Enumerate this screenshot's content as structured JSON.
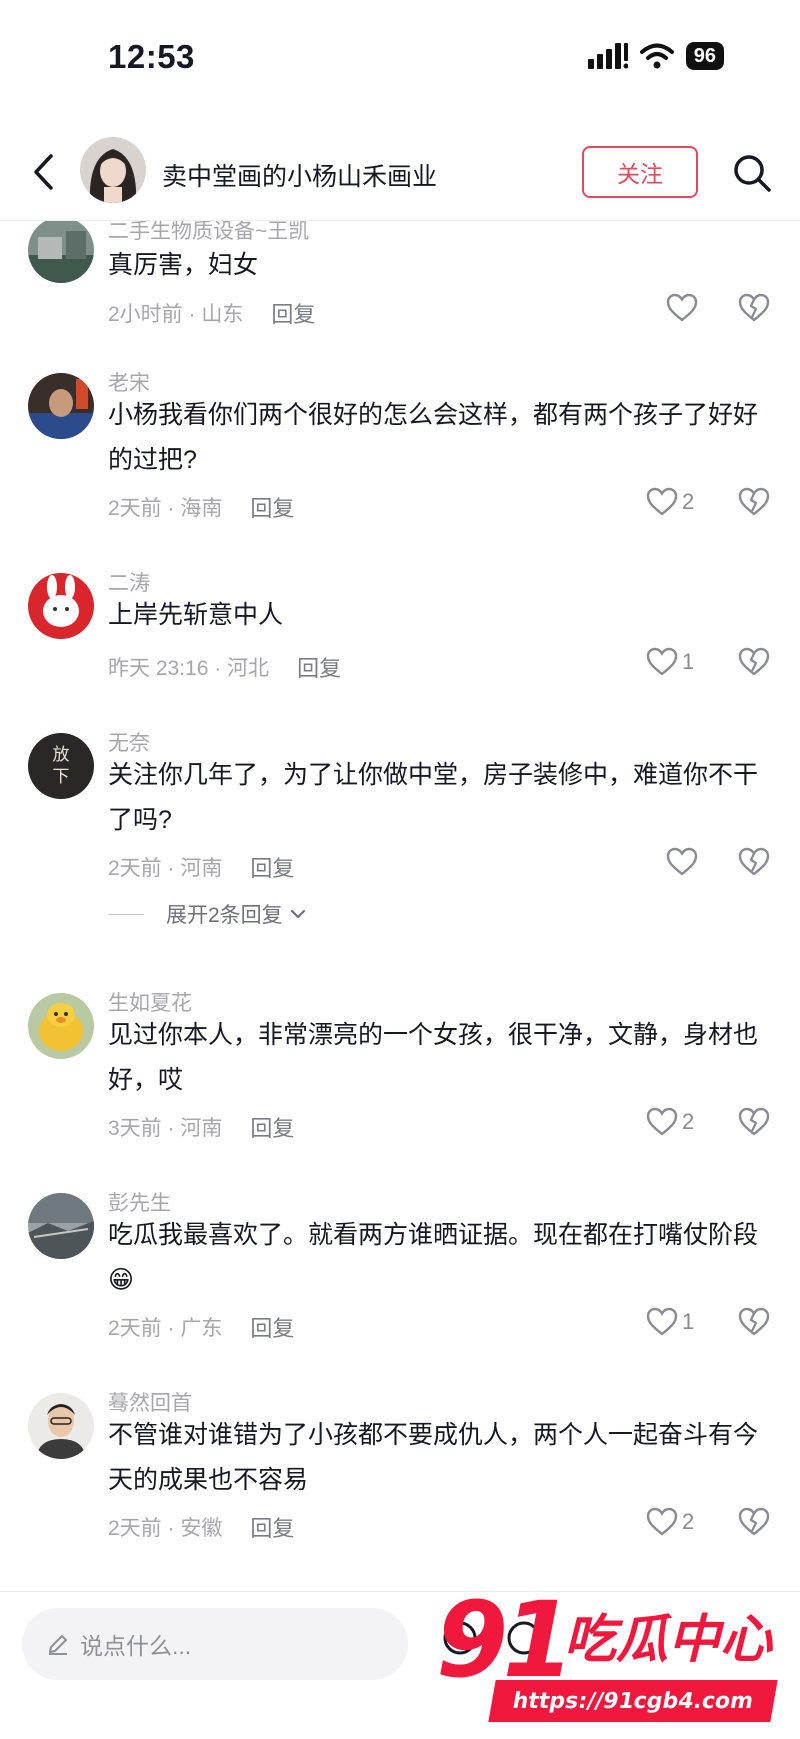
{
  "status_bar": {
    "time": "12:53",
    "battery": "96"
  },
  "header": {
    "title": "卖中堂画的小杨山禾画业",
    "follow_label": "关注"
  },
  "comments": [
    {
      "user": "二手生物质设备~王凯",
      "text": "真厉害，妇女",
      "time_location": "2小时前 · 山东",
      "reply_label": "回复",
      "likes": ""
    },
    {
      "user": "老宋",
      "text": "小杨我看你们两个很好的怎么会这样，都有两个孩子了好好的过把?",
      "time_location": "2天前 · 海南",
      "reply_label": "回复",
      "likes": "2"
    },
    {
      "user": "二涛",
      "text": "上岸先斩意中人",
      "time_location": "昨天 23:16 · 河北",
      "reply_label": "回复",
      "likes": "1"
    },
    {
      "user": "无奈",
      "text": "关注你几年了，为了让你做中堂，房子装修中，难道你不干了吗?",
      "time_location": "2天前 · 河南",
      "reply_label": "回复",
      "likes": "",
      "expand_label": "展开2条回复",
      "avatar_text": "放下"
    },
    {
      "user": "生如夏花",
      "text": "见过你本人，非常漂亮的一个女孩，很干净，文静，身材也好，哎",
      "time_location": "3天前 · 河南",
      "reply_label": "回复",
      "likes": "2"
    },
    {
      "user": "彭先生",
      "text": "吃瓜我最喜欢了。就看两方谁晒证据。现在都在打嘴仗阶段😁",
      "time_location": "2天前 · 广东",
      "reply_label": "回复",
      "likes": "1"
    },
    {
      "user": "蓦然回首",
      "text": "不管谁对谁错为了小孩都不要成仇人，两个人一起奋斗有今天的成果也不容易",
      "time_location": "2天前 · 安徽",
      "reply_label": "回复",
      "likes": "2"
    }
  ],
  "input": {
    "placeholder": "说点什么..."
  },
  "watermark": {
    "number": "91",
    "name": "吃瓜中心",
    "url": "https://91cgb4.com"
  },
  "colors": {
    "accent": "#e04a5e",
    "muted": "#a7a7ab",
    "watermark": "#f0183c"
  },
  "icons": [
    "chevron-left-icon",
    "search-icon",
    "heart-icon",
    "broken-heart-icon",
    "pencil-icon",
    "chevron-down-icon",
    "signal-icon",
    "wifi-icon"
  ]
}
